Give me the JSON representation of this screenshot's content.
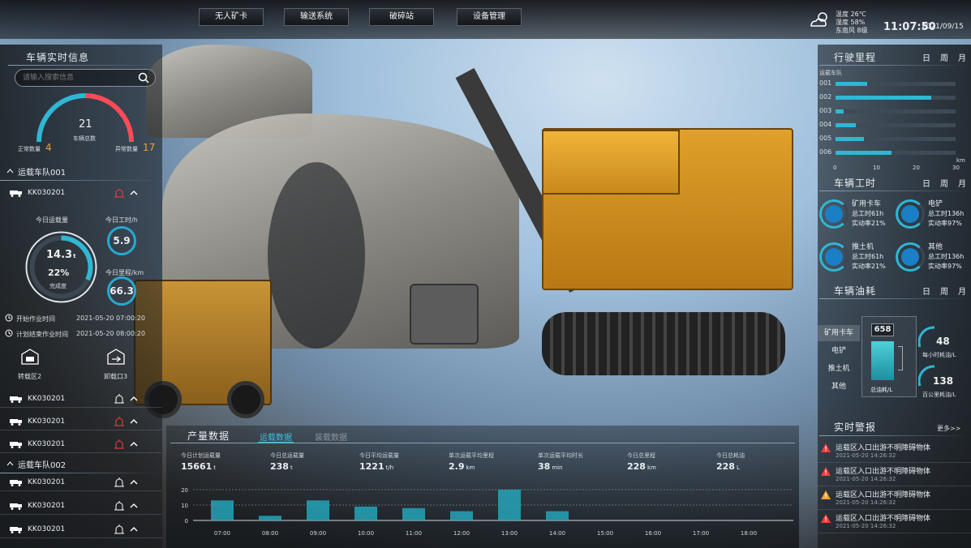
{
  "nav": {
    "tabs": [
      "无人矿卡",
      "输送系统",
      "破碎站",
      "设备管理"
    ]
  },
  "weather": {
    "temp": "温度 26℃",
    "humidity": "湿度 58%",
    "wind": "东南风 8级",
    "time": "11:07:50",
    "date": "2021/09/15"
  },
  "vehicle_info": {
    "title": "车辆实时信息",
    "search_placeholder": "请输入搜索信息",
    "total": "21",
    "total_label": "车辆总数",
    "normal_label": "正常数量",
    "normal": "4",
    "abnormal_label": "异常数量",
    "abnormal": "17",
    "group1": "运载车队001",
    "detail_vehicle": "KK030201",
    "today_load_label": "今日运载量",
    "load_val": "14.3",
    "load_unit": "t",
    "complete_pct": "22%",
    "complete_label": "完成度",
    "hours_label": "今日工时/h",
    "hours": "5.9",
    "mileage_label": "今日里程/km",
    "mileage": "66.3",
    "start_label": "开始作业时间",
    "start": "2021-05-20 07:00:20",
    "end_label": "计划结束作业时间",
    "end": "2021-05-20 08:00:20",
    "zone1": "转载区2",
    "zone2": "卸载口3",
    "rows_g1": [
      {
        "name": "KK030201",
        "alarm": "white"
      },
      {
        "name": "KK030201",
        "alarm": "red"
      },
      {
        "name": "KK030201",
        "alarm": "red"
      }
    ],
    "group2": "运载车队002",
    "rows_g2": [
      {
        "name": "KK030201"
      },
      {
        "name": "KK030201"
      },
      {
        "name": "KK030201"
      }
    ]
  },
  "mileage": {
    "title": "行驶里程",
    "periods": [
      "日",
      "周",
      "月"
    ],
    "fleet_label": "运载车队",
    "ids": [
      "001",
      "002",
      "003",
      "004",
      "005",
      "006"
    ],
    "values": [
      8,
      24,
      2,
      5,
      7,
      14
    ],
    "max": 30,
    "ticks": [
      "0",
      "10",
      "20",
      "30"
    ],
    "unit": "km"
  },
  "work_hours": {
    "title": "车辆工时",
    "periods": [
      "日",
      "周",
      "月"
    ],
    "cards": [
      {
        "name": "矿用卡车",
        "hours": "总工时61h",
        "rate": "实动率21%",
        "icon": "truck-icon"
      },
      {
        "name": "电铲",
        "hours": "总工时136h",
        "rate": "实动率97%",
        "icon": "shovel-icon"
      },
      {
        "name": "推土机",
        "hours": "总工时61h",
        "rate": "实动率21%",
        "icon": "bulldozer-icon"
      },
      {
        "name": "其他",
        "hours": "总工时136h",
        "rate": "实动率97%",
        "icon": "more-icon"
      }
    ]
  },
  "fuel": {
    "title": "车辆油耗",
    "periods": [
      "日",
      "周",
      "月"
    ],
    "types": [
      "矿用卡车",
      "电铲",
      "推土机",
      "其他"
    ],
    "total": "658",
    "total_label": "总油耗/L",
    "per_hour": "48",
    "per_hour_label": "每小时耗油/L",
    "per_100km": "138",
    "per_100km_label": "百公里耗油/L"
  },
  "alerts": {
    "title": "实时警报",
    "more": "更多>>",
    "items": [
      {
        "text": "运载区入口出游不明障碍物体",
        "time": "2021-05-20 14:26:32",
        "level": "red"
      },
      {
        "text": "运载区入口出游不明障碍物体",
        "time": "2021-05-20 14:26:32",
        "level": "red"
      },
      {
        "text": "运载区入口出游不明障碍物体",
        "time": "2021-05-20 14:26:32",
        "level": "orange"
      },
      {
        "text": "运载区入口出游不明障碍物体",
        "time": "2021-05-20 14:26:32",
        "level": "red"
      }
    ]
  },
  "production": {
    "title": "产量数据",
    "tab_active": "运载数据",
    "tab_inactive": "装载数据",
    "metrics": [
      {
        "label": "今日计划运载量",
        "value": "15661",
        "unit": "t"
      },
      {
        "label": "今日总运载量",
        "value": "238",
        "unit": "t"
      },
      {
        "label": "今日平均运载量",
        "value": "1221",
        "unit": "t/h"
      },
      {
        "label": "单次运载平均里程",
        "value": "2.9",
        "unit": "km"
      },
      {
        "label": "单次运载平均时长",
        "value": "38",
        "unit": "min"
      },
      {
        "label": "今日总里程",
        "value": "228",
        "unit": "km"
      },
      {
        "label": "今日总耗油",
        "value": "228",
        "unit": "L"
      }
    ]
  },
  "chart_data": {
    "type": "bar",
    "categories": [
      "07:00",
      "08:00",
      "09:00",
      "10:00",
      "11:00",
      "12:00",
      "13:00",
      "14:00",
      "15:00",
      "16:00",
      "17:00",
      "18:00"
    ],
    "values": [
      13,
      3,
      13,
      9,
      8,
      6,
      20,
      6,
      0,
      0,
      0,
      0
    ],
    "ylim": [
      0,
      20
    ],
    "yticks": [
      "0",
      "10",
      "20"
    ],
    "grid": true,
    "color": "#24a4b8"
  }
}
